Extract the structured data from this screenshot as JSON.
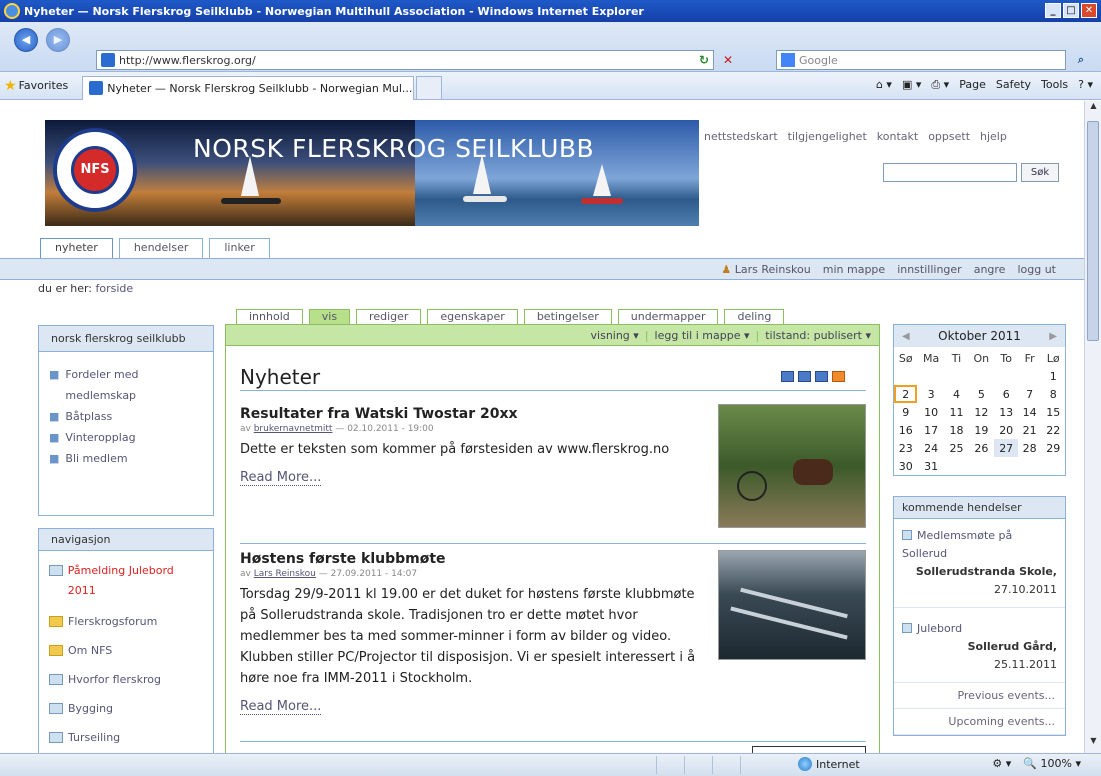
{
  "window": {
    "title": "Nyheter — Norsk Flerskrog Seilklubb - Norwegian Multihull Association - Windows Internet Explorer",
    "address": "http://www.flerskrog.org/",
    "search_placeholder": "Google",
    "favorites_label": "Favorites",
    "tab_title": "Nyheter — Norsk Flerskrog Seilklubb - Norwegian Mul...",
    "command_items": [
      "Page",
      "Safety",
      "Tools"
    ]
  },
  "site": {
    "banner_title": "NORSK FLERSKROG SEILKLUBB",
    "logo_text": "NFS",
    "site_actions": [
      "nettstedskart",
      "tilgjengelighet",
      "kontakt",
      "oppsett",
      "hjelp"
    ],
    "search_button": "Søk",
    "portal_tabs": [
      "nyheter",
      "hendelser",
      "linker"
    ],
    "personal_bar": [
      "Lars Reinskou",
      "min mappe",
      "innstillinger",
      "angre",
      "logg ut"
    ],
    "breadcrumb_label": "du er her:",
    "breadcrumb_link": "forside"
  },
  "left": {
    "club_portlet": {
      "title": "norsk flerskrog seilklubb",
      "items": [
        "Fordeler med medlemskap",
        "Båtplass",
        "Vinteropplag",
        "Bli medlem"
      ]
    },
    "nav_portlet": {
      "title": "navigasjon",
      "items": [
        "Påmelding Julebord 2011",
        "Flerskrogsforum",
        "Om NFS",
        "Hvorfor flerskrog",
        "Bygging",
        "Turseiling"
      ]
    }
  },
  "content": {
    "tabs": [
      "innhold",
      "vis",
      "rediger",
      "egenskaper",
      "betingelser",
      "undermapper",
      "deling"
    ],
    "actions": [
      "visning ▾",
      "legg til i mappe ▾",
      "tilstand: publisert ▾"
    ],
    "heading": "Nyheter",
    "news": [
      {
        "title": "Resultater fra Watski Twostar 20xx",
        "by": "av",
        "author": "brukernavnetmitt",
        "date": "— 02.10.2011 - 19:00",
        "text": "Dette er teksten som kommer på førstesiden av www.flerskrog.no",
        "more": "Read More..."
      },
      {
        "title": "Høstens første klubbmøte",
        "by": "av",
        "author": "Lars Reinskou",
        "date": "— 27.09.2011 - 14:07",
        "text": "Torsdag 29/9-2011 kl 19.00 er det duket for høstens første klubbmøte på Sollerudstranda skole. Tradisjonen tro er dette møtet hvor medlemmer bes ta med sommer-minner i form av bilder og video. Klubben stiller PC/Projector til disposisjon. Vi er spesielt interessert i å høre noe fra IMM-2011 i Stockholm.",
        "more": "Read More..."
      }
    ]
  },
  "calendar": {
    "month": "Oktober 2011",
    "days": [
      "Sø",
      "Ma",
      "Ti",
      "On",
      "To",
      "Fr",
      "Lø"
    ],
    "weeks": [
      [
        "",
        "",
        "",
        "",
        "",
        "",
        "1"
      ],
      [
        "2",
        "3",
        "4",
        "5",
        "6",
        "7",
        "8"
      ],
      [
        "9",
        "10",
        "11",
        "12",
        "13",
        "14",
        "15"
      ],
      [
        "16",
        "17",
        "18",
        "19",
        "20",
        "21",
        "22"
      ],
      [
        "23",
        "24",
        "25",
        "26",
        "27",
        "28",
        "29"
      ],
      [
        "30",
        "31",
        "",
        "",
        "",
        "",
        ""
      ]
    ]
  },
  "events": {
    "title": "kommende hendelser",
    "items": [
      {
        "title": "Medlemsmøte på Sollerud",
        "location": "Sollerudstranda Skole,",
        "date": "27.10.2011"
      },
      {
        "title": "Julebord",
        "location": "Sollerud Gård,",
        "date": "25.11.2011"
      }
    ],
    "previous": "Previous events...",
    "upcoming": "Upcoming events..."
  },
  "status": {
    "zone": "Internet",
    "zoom": "100%"
  },
  "colors": {
    "titlebar": "#1f59c8",
    "portal_blue": "#dce7f3",
    "content_green": "#c6e6a6",
    "link": "#555577",
    "red_link": "#e02020"
  }
}
